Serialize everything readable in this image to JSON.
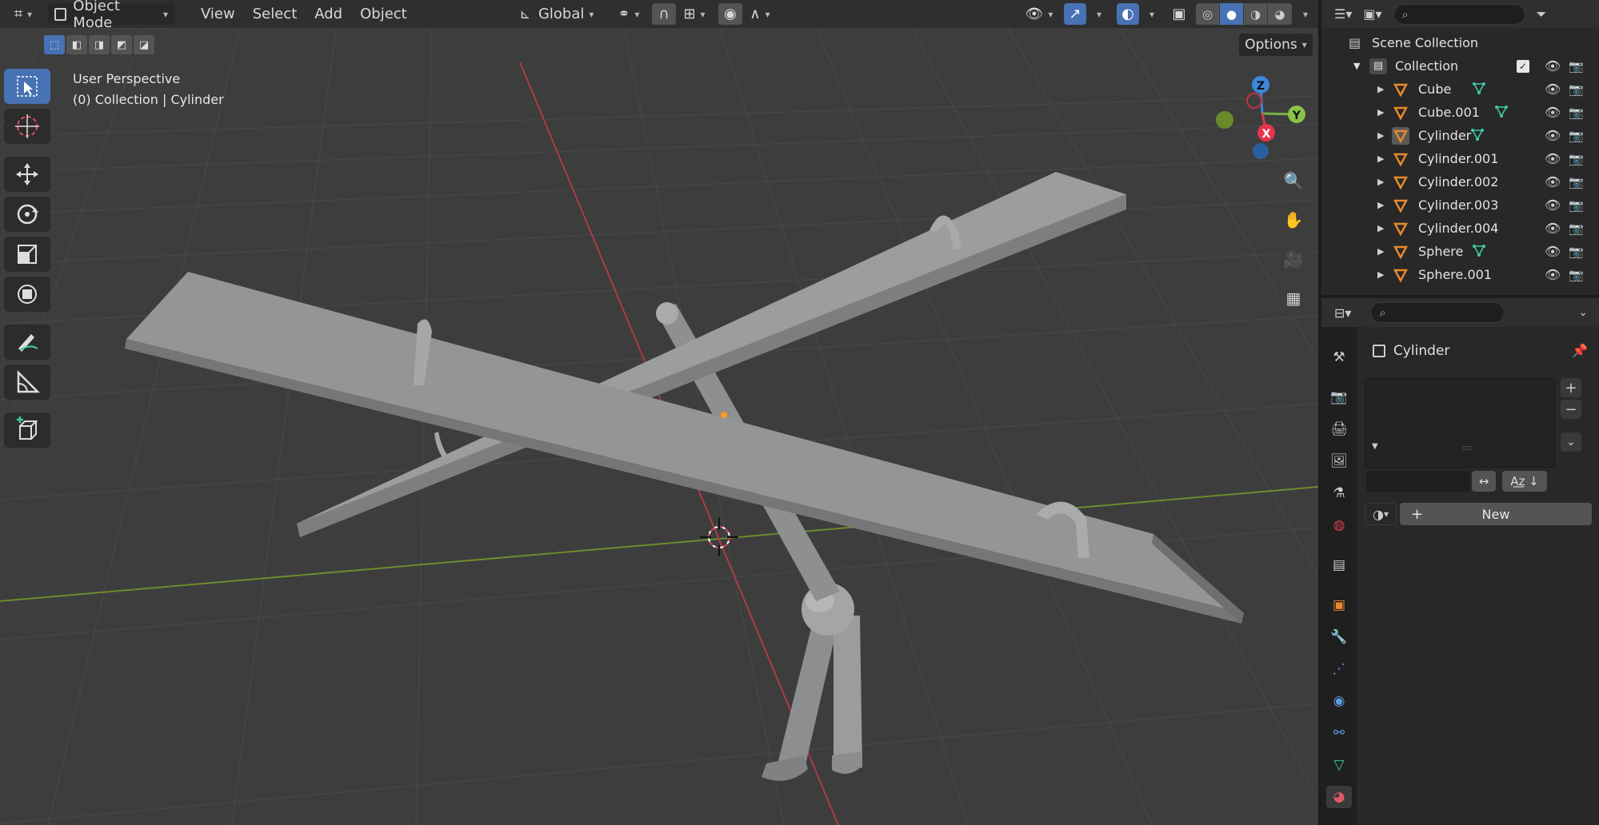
{
  "header": {
    "mode": "Object Mode",
    "menus": [
      "View",
      "Select",
      "Add",
      "Object"
    ],
    "orientation": "Global",
    "options_label": "Options"
  },
  "viewport": {
    "view_name": "User Perspective",
    "context": "(0) Collection | Cylinder"
  },
  "gizmo": {
    "z": "Z",
    "y": "Y",
    "x": "X"
  },
  "outliner": {
    "root": "Scene Collection",
    "collection": "Collection",
    "items": [
      "Cube",
      "Cube.001",
      "Cylinder",
      "Cylinder.001",
      "Cylinder.002",
      "Cylinder.003",
      "Cylinder.004",
      "Sphere",
      "Sphere.001"
    ]
  },
  "properties": {
    "object_name": "Cylinder",
    "new_label": "New"
  },
  "colors": {
    "accent": "#4772b3",
    "object_orange": "#e8892d",
    "mesh_green": "#3fc9a6",
    "axis_x": "#c73142",
    "axis_y": "#76a33a"
  }
}
